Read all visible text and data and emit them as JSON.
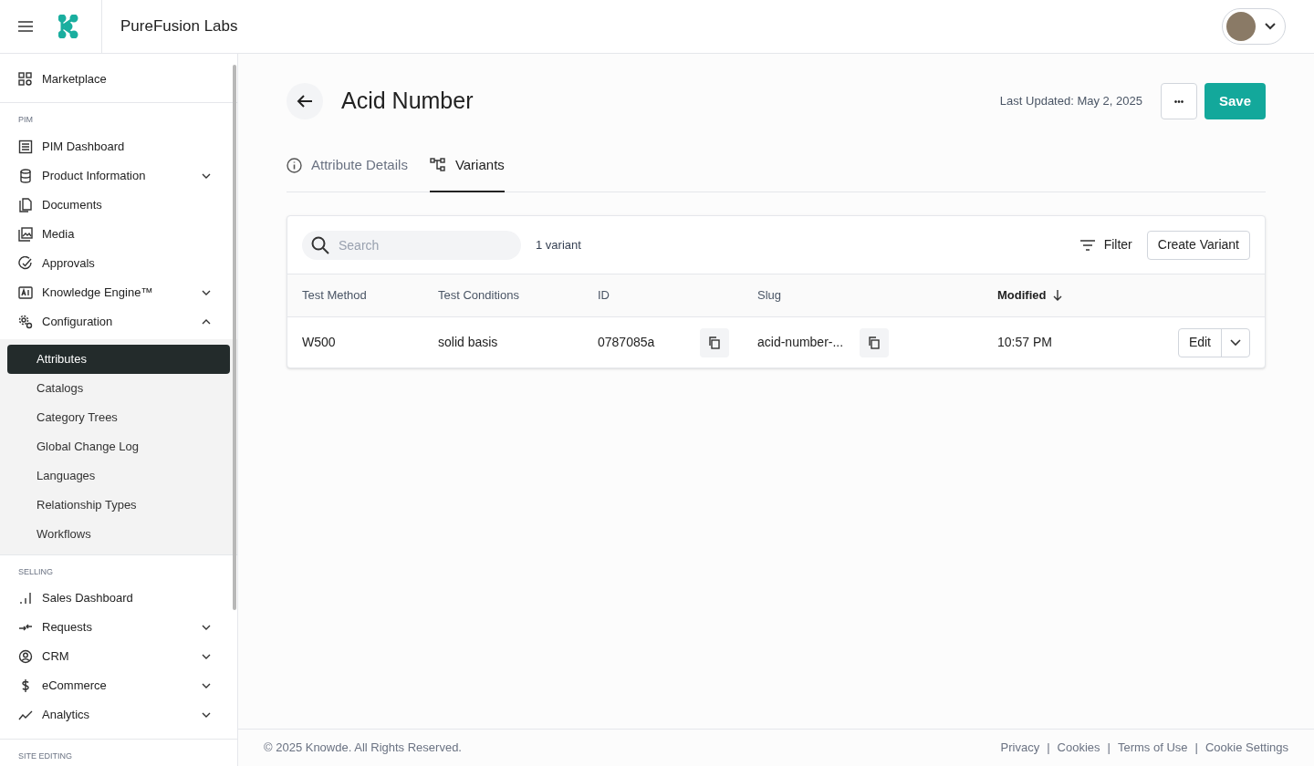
{
  "header": {
    "org_name": "PureFusion Labs"
  },
  "sidebar": {
    "top_items": [
      {
        "label": "Marketplace",
        "selected": false
      }
    ],
    "sections": [
      {
        "title": "PIM",
        "items": [
          {
            "label": "PIM Dashboard",
            "selected": false
          },
          {
            "label": "Product Information",
            "selected": false,
            "expanded": false
          },
          {
            "label": "Documents",
            "selected": false
          },
          {
            "label": "Media",
            "selected": false
          },
          {
            "label": "Approvals",
            "selected": false
          },
          {
            "label": "Knowledge Engine™",
            "selected": false,
            "expanded": false
          },
          {
            "label": "Configuration",
            "selected": false,
            "expanded": true,
            "children": [
              {
                "label": "Attributes",
                "selected": true
              },
              {
                "label": "Catalogs",
                "selected": false
              },
              {
                "label": "Category Trees",
                "selected": false
              },
              {
                "label": "Global Change Log",
                "selected": false
              },
              {
                "label": "Languages",
                "selected": false
              },
              {
                "label": "Relationship Types",
                "selected": false
              },
              {
                "label": "Workflows",
                "selected": false
              }
            ]
          }
        ]
      },
      {
        "title": "SELLING",
        "items": [
          {
            "label": "Sales Dashboard",
            "selected": false
          },
          {
            "label": "Requests",
            "selected": false,
            "expanded": false
          },
          {
            "label": "CRM",
            "selected": false,
            "expanded": false
          },
          {
            "label": "eCommerce",
            "selected": false,
            "expanded": false
          },
          {
            "label": "Analytics",
            "selected": false,
            "expanded": false
          }
        ]
      },
      {
        "title": "SITE EDITING"
      }
    ]
  },
  "page": {
    "title": "Acid Number",
    "last_updated": "Last Updated: May 2, 2025",
    "more_button": "•••",
    "save_button": "Save",
    "tabs": [
      {
        "label": "Attribute Details",
        "selected": false
      },
      {
        "label": "Variants",
        "selected": true
      }
    ]
  },
  "variants": {
    "search": {
      "placeholder": "Search"
    },
    "count": "1 variant",
    "filter_button": "Filter",
    "create_button": "Create Variant",
    "columns": [
      {
        "label": "Test Method",
        "sorted": false
      },
      {
        "label": "Test Conditions",
        "sorted": false
      },
      {
        "label": "ID",
        "sorted": false
      },
      {
        "label": "Slug",
        "sorted": false
      },
      {
        "label": "Modified",
        "sorted": true
      }
    ],
    "rows": [
      {
        "test_method": "W500",
        "test_conditions": "solid basis",
        "id": "0787085a",
        "slug": "acid-number-...",
        "modified": "10:57 PM",
        "edit_button": "Edit"
      }
    ]
  },
  "footer": {
    "copyright": "© 2025 Knowde. All Rights Reserved.",
    "links": [
      "Privacy",
      "Cookies",
      "Terms of Use",
      "Cookie Settings"
    ],
    "separator": "|"
  }
}
